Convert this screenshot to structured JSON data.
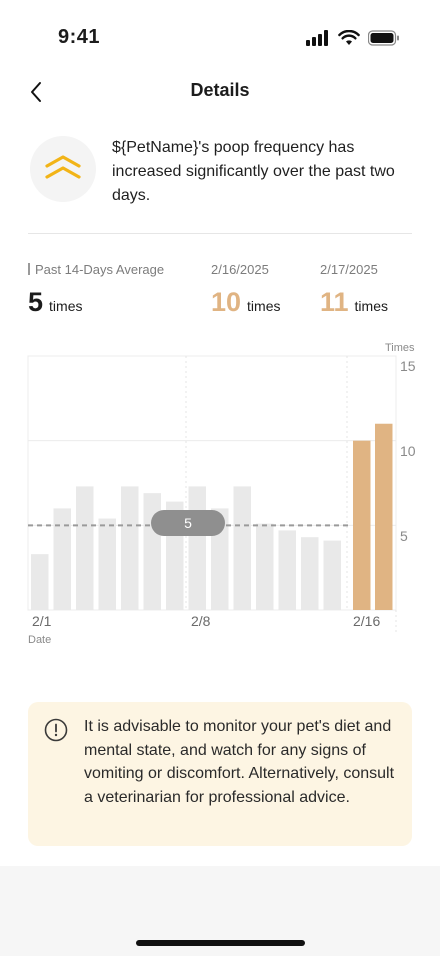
{
  "status_bar": {
    "time": "9:41"
  },
  "nav": {
    "title": "Details"
  },
  "alert": {
    "message": "${PetName}'s poop frequency has increased significantly over the past two days."
  },
  "stats": [
    {
      "label": "Past 14-Days Average",
      "value": "5",
      "unit": "times",
      "highlight": false
    },
    {
      "label": "2/16/2025",
      "value": "10",
      "unit": "times",
      "highlight": true
    },
    {
      "label": "2/17/2025",
      "value": "11",
      "unit": "times",
      "highlight": true
    }
  ],
  "chart_data": {
    "type": "bar",
    "ylabel": "Times",
    "xlabel": "Date",
    "ylim": [
      0,
      15
    ],
    "yticks": [
      "15",
      "10",
      "5"
    ],
    "xticks": [
      "2/1",
      "2/8",
      "2/16"
    ],
    "average": 5,
    "average_label": "5",
    "categories": [
      "2/1",
      "2/2",
      "2/3",
      "2/4",
      "2/5",
      "2/6",
      "2/7",
      "2/8",
      "2/9",
      "2/10",
      "2/11",
      "2/12",
      "2/13",
      "2/14",
      "2/15",
      "2/16",
      "2/17"
    ],
    "values": [
      3.3,
      6,
      7.3,
      5.4,
      7.3,
      6.9,
      6.4,
      7.3,
      6,
      7.3,
      5.1,
      4.7,
      4.3,
      4.1,
      null,
      10,
      11
    ],
    "colors": {
      "normal": "#e9e9e9",
      "highlight": "#e0b483"
    }
  },
  "advice": {
    "text": " It is advisable to monitor your pet's diet and mental state, and watch for any signs of vomiting or discomfort. Alternatively, consult a veterinarian for professional advice."
  },
  "colors": {
    "accent": "#e0b483",
    "alert_icon": "#f2b417",
    "card_bg": "#fdf5e3"
  }
}
